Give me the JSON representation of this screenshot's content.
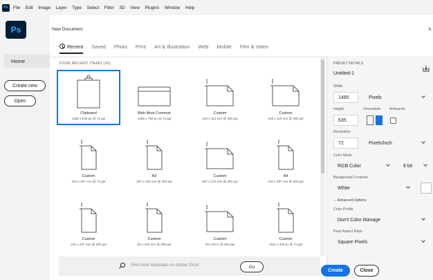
{
  "menubar": {
    "app_icon": "Ps",
    "items": [
      "File",
      "Edit",
      "Image",
      "Layer",
      "Type",
      "Select",
      "Filter",
      "3D",
      "View",
      "Plugins",
      "Window",
      "Help"
    ]
  },
  "left_panel": {
    "logo": "Ps",
    "home": "Home",
    "create_new": "Create new",
    "open": "Open"
  },
  "dialog": {
    "title": "New Document",
    "close": "×",
    "tabs": [
      "Recent",
      "Saved",
      "Photo",
      "Print",
      "Art & Illustration",
      "Web",
      "Mobile",
      "Film & Video"
    ],
    "recent_label": "YOUR RECENT ITEMS (20)",
    "items": [
      {
        "name": "Clipboard",
        "size": "1485 x 635 px @ 72 ppi",
        "icon": "clipboard-icon",
        "selected": true
      },
      {
        "name": "Web Most Common",
        "size": "1366 x 768 px @ 72 ppi",
        "icon": "browser-window-icon"
      },
      {
        "name": "Custom",
        "size": "210 x 112 mm @ 300 ppi",
        "icon": "landscape-document-icon"
      },
      {
        "name": "Custom",
        "size": "210 x 110 mm @ 300 ppi",
        "icon": "landscape-document-icon"
      },
      {
        "name": "Custom",
        "size": "210 x 297 mm @ 72 ppi",
        "icon": "portrait-document-icon"
      },
      {
        "name": "A3",
        "size": "297 x 420 mm @ 300 ppi",
        "icon": "portrait-document-icon"
      },
      {
        "name": "Custom",
        "size": "297 x 210 mm @ 300 ppi",
        "icon": "landscape-document-icon"
      },
      {
        "name": "A4",
        "size": "210 x 297 mm @ 300 ppi",
        "icon": "portrait-document-icon"
      },
      {
        "name": "Custom",
        "size": "210 x 297 mm @ 300 ppi",
        "icon": "portrait-document-icon"
      },
      {
        "name": "Custom",
        "size": "60 x 210 mm @ 300 ppi",
        "icon": "portrait-document-icon"
      },
      {
        "name": "Custom",
        "size": "95 x 55 in @ 300 ppi",
        "icon": "landscape-document-icon"
      },
      {
        "name": "Custom",
        "size": "1811 x 339 px @ 72 ppi",
        "icon": "portrait-document-icon"
      }
    ],
    "stock_placeholder": "Find more templates on Adobe Stock",
    "go": "Go"
  },
  "preset": {
    "header": "PRESET DETAILS",
    "name": "Untitled-1",
    "width_label": "Width",
    "width": "1485",
    "width_unit": "Pixels",
    "height_label": "Height",
    "height": "635",
    "orientation_label": "Orientation",
    "artboards_label": "Artboards",
    "resolution_label": "Resolution",
    "resolution": "72",
    "resolution_unit": "Pixels/Inch",
    "color_mode_label": "Color Mode",
    "color_mode": "RGB Color",
    "bit_depth": "8 bit",
    "bg_label": "Background Contents",
    "bg": "White",
    "advanced": "Advanced Options",
    "profile_label": "Color Profile",
    "profile": "Don't Color Manage",
    "pixel_ratio_label": "Pixel Aspect Ratio",
    "pixel_ratio": "Square Pixels"
  },
  "actions": {
    "create": "Create",
    "close": "Close"
  },
  "colors": {
    "accent": "#1473e6",
    "ps_bg": "#001e36",
    "ps_fg": "#31a8ff"
  }
}
